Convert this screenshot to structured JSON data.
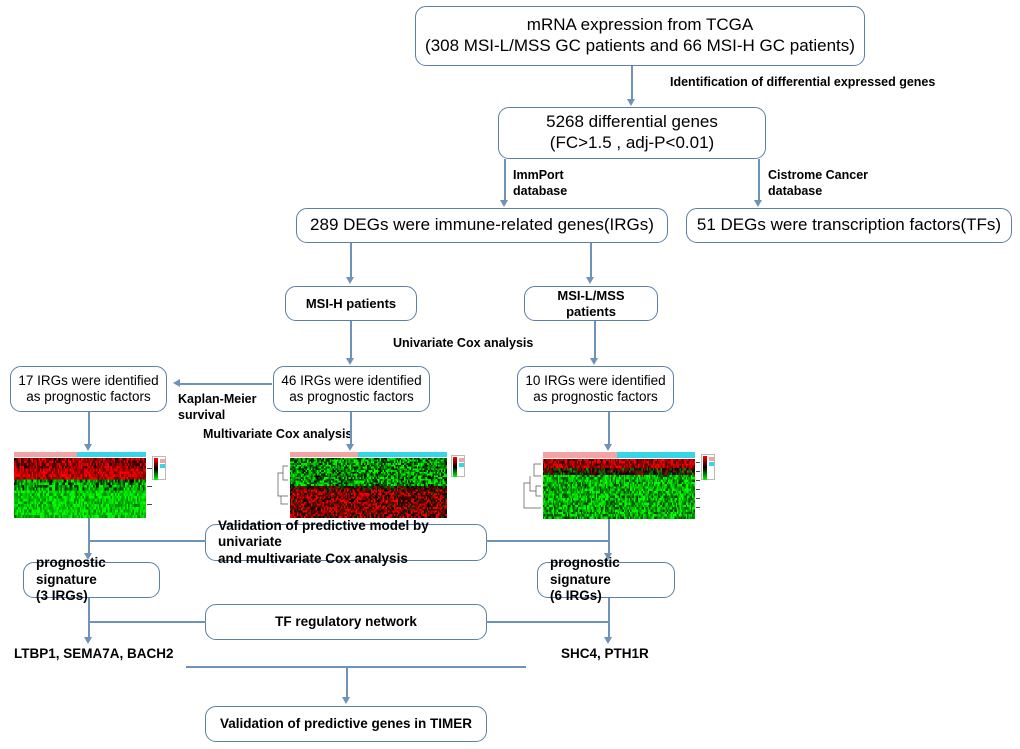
{
  "diagram": {
    "title": "Study workflow for immune-related gene prognostic signatures in gastric cancer",
    "accent_border": "#5b7fa6",
    "accent_line": "#6e93ba",
    "nodes": {
      "tcga": "mRNA expression from TCGA\n(308 MSI-L/MSS GC patients and 66 MSI-H GC patients)",
      "deg": "5268 differential genes\n(FC>1.5 , adj-P<0.01)",
      "irg": "289 DEGs were immune-related genes(IRGs)",
      "tf": "51 DEGs  were transcription factors(TFs)",
      "msih": "MSI-H patients",
      "msilmss": "MSI-L/MSS patients",
      "irg17": "17 IRGs were identified\nas prognostic factors",
      "irg46": "46 IRGs were identified\nas prognostic factors",
      "irg10": "10 IRGs were identified\nas prognostic factors",
      "validation_model": "Validation of predictive model by univariate\nand multivariate Cox analysis",
      "sig3": "prognostic signature\n(3 IRGs)",
      "sig6": "prognostic signature\n(6 IRGs)",
      "tf_network": "TF regulatory network",
      "validation_timer": "Validation of predictive genes in TIMER"
    },
    "edge_labels": {
      "identification": "Identification of differential expressed genes",
      "immport": "ImmPort\ndatabase",
      "cistrome": "Cistrome Cancer\ndatabase",
      "univariate": "Univariate Cox analysis",
      "km": "Kaplan-Meier\nsurvival",
      "multivariate": "Multivariate Cox analysis"
    },
    "gene_lists": {
      "left": "LTBP1, SEMA7A, BACH2",
      "right": "SHC4, PTH1R"
    },
    "heatmaps": [
      {
        "name": "heatmap-msih-17irgs",
        "group_colors": [
          "#f3a3a3",
          "#35d6e8"
        ],
        "dominant": "red-top-green-bottom",
        "has_dendrogram": false
      },
      {
        "name": "heatmap-msih-46irgs",
        "group_colors": [
          "#f3a3a3",
          "#35d6e8"
        ],
        "dominant": "green-top-red-bottom",
        "has_dendrogram": true
      },
      {
        "name": "heatmap-msilmss-10irgs",
        "group_colors": [
          "#f3a3a3",
          "#35d6e8"
        ],
        "dominant": "red-top-green-body",
        "has_dendrogram": true
      }
    ]
  }
}
